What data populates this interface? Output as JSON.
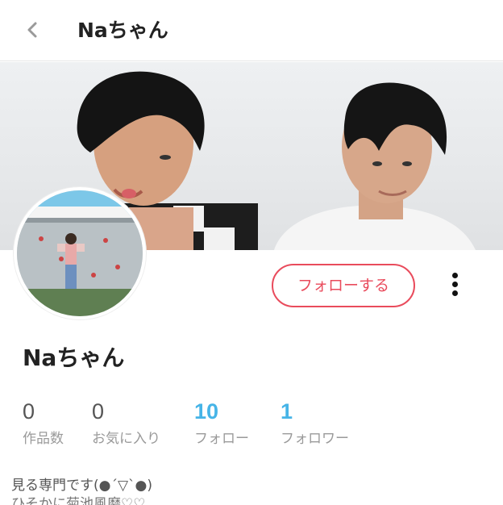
{
  "header": {
    "title": "Naちゃん"
  },
  "profile": {
    "name": "Naちゃん",
    "follow_label": "フォローする",
    "stats": [
      {
        "value": "0",
        "label": "作品数",
        "accent": false
      },
      {
        "value": "0",
        "label": "お気に入り",
        "accent": false
      },
      {
        "value": "10",
        "label": "フォロー",
        "accent": true
      },
      {
        "value": "1",
        "label": "フォロワー",
        "accent": true
      }
    ],
    "bio_line1": "見る専門です(●´▽`●)",
    "bio_line2": "ひそかに菊池風磨♡♡"
  },
  "colors": {
    "accent_blue": "#46b4e7",
    "follow_red": "#e94b5c"
  },
  "icons": {
    "back": "chevron-left-icon",
    "more": "vertical-ellipsis-icon"
  }
}
